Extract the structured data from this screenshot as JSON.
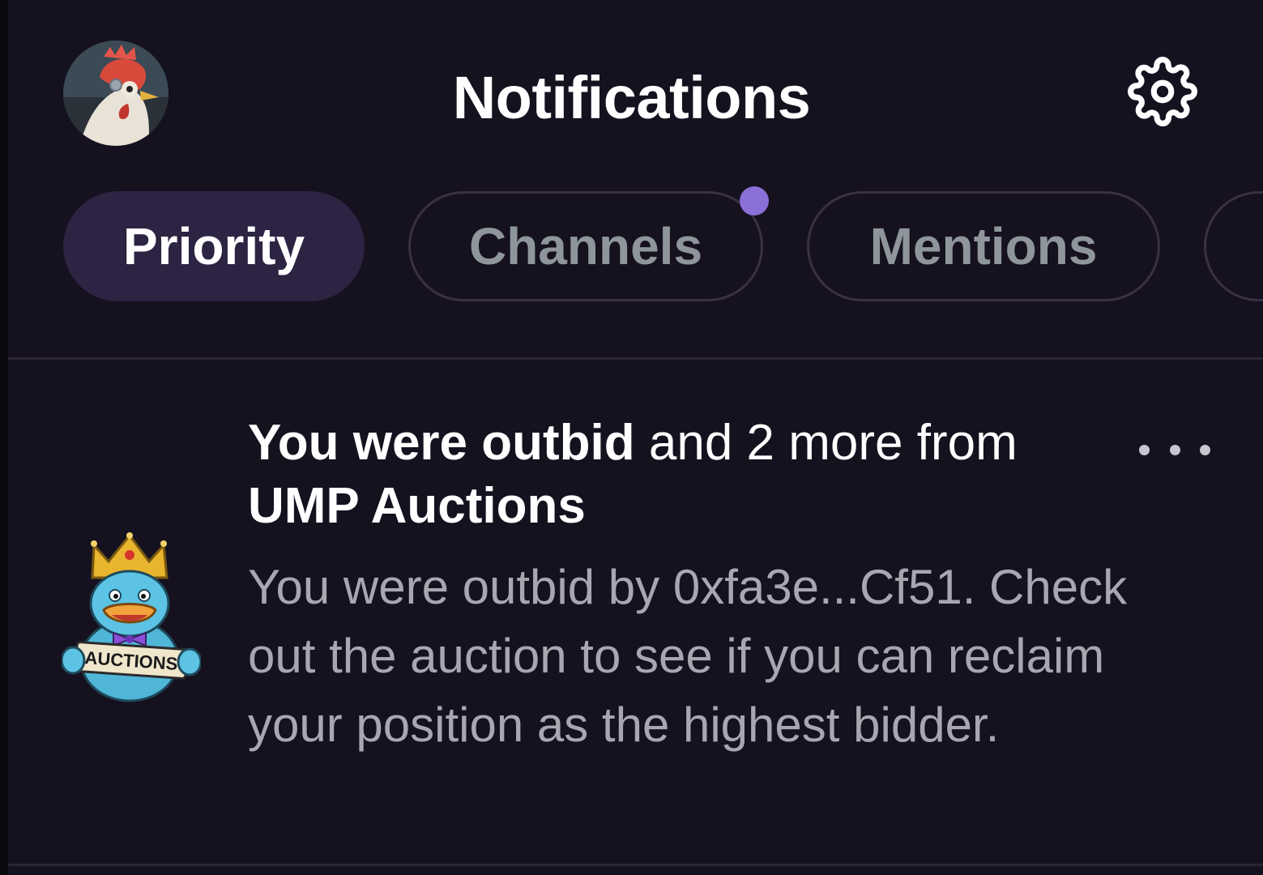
{
  "header": {
    "title": "Notifications",
    "avatar_icon": "rooster-avatar",
    "settings_icon": "gear-icon"
  },
  "tabs": [
    {
      "label": "Priority",
      "active": true
    },
    {
      "label": "Channels",
      "active": false,
      "unread": true
    },
    {
      "label": "Mentions",
      "active": false
    },
    {
      "label": "",
      "active": false
    }
  ],
  "notification": {
    "icon": "auctions-duck-icon",
    "icon_text": "AUCTIONS",
    "title_strong": "You were outbid",
    "title_middle": " and 2 more from ",
    "title_source": "UMP Auctions",
    "body": "You were outbid by 0xfa3e...Cf51. Check out the auction to see if you can reclaim your position as the highest bidder.",
    "menu_icon": "more-horizontal-icon"
  },
  "colors": {
    "background": "#15111f",
    "active_tab": "#2c2442",
    "unread_dot": "#8a6fd6",
    "muted_text": "#a9a6b1",
    "tab_text": "#8e969c"
  }
}
